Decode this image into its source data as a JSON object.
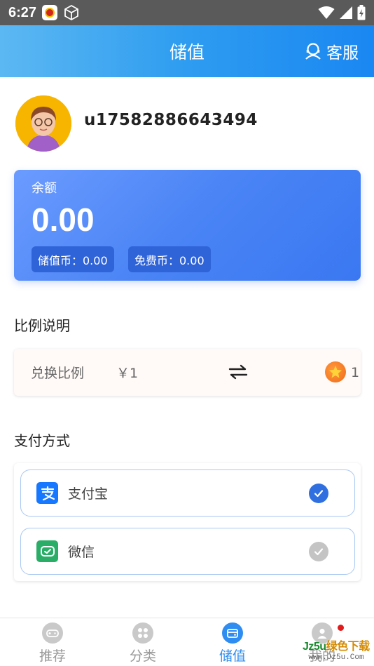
{
  "status_bar": {
    "time": "6:27"
  },
  "header": {
    "title": "储值",
    "service_label": "客服"
  },
  "user": {
    "username": "u17582886643494"
  },
  "balance": {
    "label": "余额",
    "value": "0.00",
    "stored_coins": "储值币：0.00",
    "free_coins": "免费币：0.00"
  },
  "ratio_section": {
    "title": "比例说明",
    "label": "兑换比例",
    "amount": "￥1",
    "coin_count": "1"
  },
  "payment_section": {
    "title": "支付方式",
    "options": [
      {
        "label": "支付宝",
        "selected": true,
        "icon": "alipay-icon",
        "color": "#1677ff"
      },
      {
        "label": "微信",
        "selected": false,
        "icon": "wechat-icon",
        "color": "#2aae67"
      }
    ]
  },
  "bottom_nav": {
    "items": [
      {
        "label": "推荐",
        "icon": "gamepad-icon",
        "active": false
      },
      {
        "label": "分类",
        "icon": "grid-icon",
        "active": false
      },
      {
        "label": "储值",
        "icon": "wallet-icon",
        "active": true
      },
      {
        "label": "我的",
        "icon": "user-icon",
        "active": false
      }
    ]
  },
  "watermark": {
    "line1_a": "Jz5u",
    "line1_b": "绿色下载",
    "line2": "www.Jz5u.Com"
  },
  "colors": {
    "primary": "#2f8cf0",
    "card": "#4a84f5",
    "alert": "#e01b1b"
  }
}
